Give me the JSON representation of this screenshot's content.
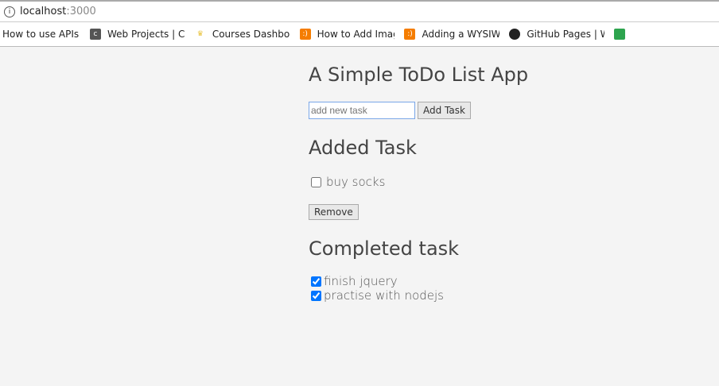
{
  "browser": {
    "host": "localhost",
    "port": ":3000",
    "bookmarks": [
      {
        "label": "How to use APIs with",
        "icon": "none",
        "color": "#fff"
      },
      {
        "label": "Web Projects | Codec",
        "icon": "codecademy-icon",
        "color": "#555"
      },
      {
        "label": "Courses Dashboard |",
        "icon": "crown-icon",
        "color": "#e8c23a"
      },
      {
        "label": "How to Add Image U",
        "icon": "blogger-icon",
        "color": "#f57d00"
      },
      {
        "label": "Adding a WYSIWYG H",
        "icon": "blogger-icon",
        "color": "#f57d00"
      },
      {
        "label": "GitHub Pages | Webs",
        "icon": "github-icon",
        "color": "#222"
      },
      {
        "label": "",
        "icon": "green-icon",
        "color": "#2da44e"
      }
    ]
  },
  "app": {
    "title": "A Simple ToDo List App",
    "input_placeholder": "add new task",
    "add_label": "Add Task",
    "added_heading": "Added Task",
    "added_tasks": [
      "buy socks"
    ],
    "remove_label": "Remove",
    "completed_heading": "Completed task",
    "completed_tasks": [
      "finish jquery",
      "practise with nodejs"
    ]
  }
}
